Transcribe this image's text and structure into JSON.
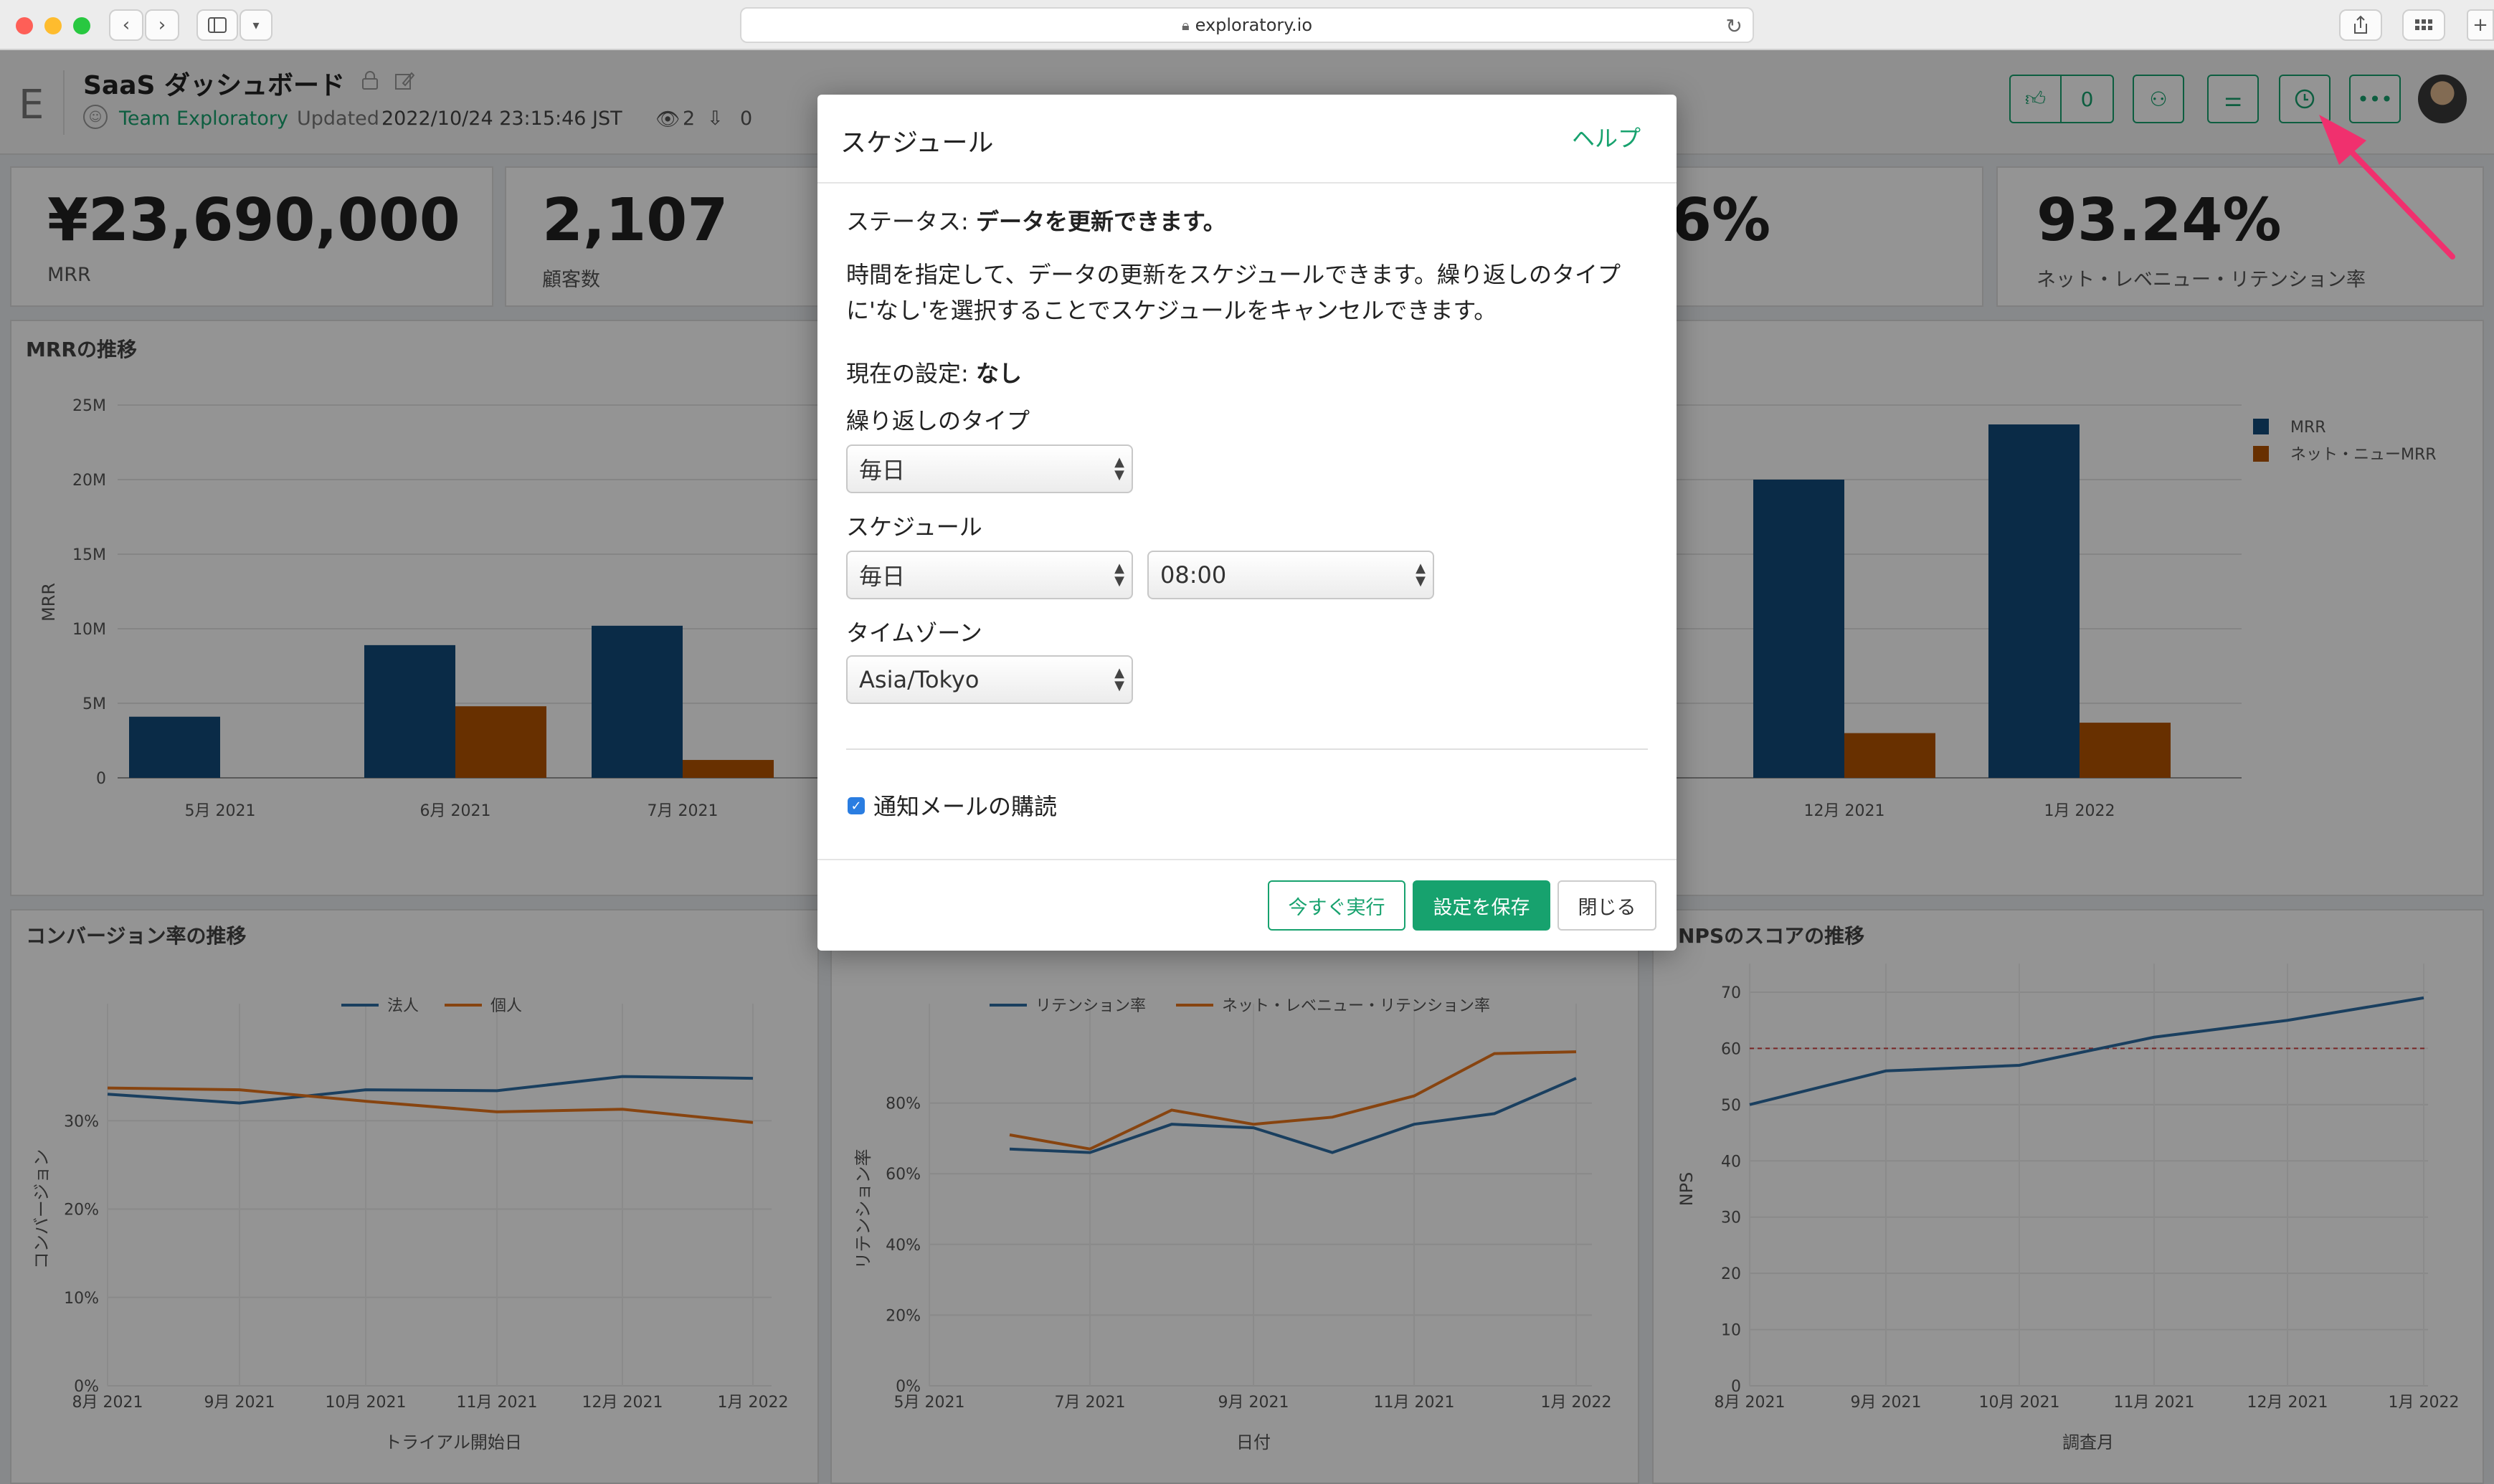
{
  "browser": {
    "url": "exploratory.io",
    "icons": {
      "back": "chevron-left-icon",
      "forward": "chevron-right-icon",
      "sidebar": "sidebar-icon",
      "lock": "lock-icon",
      "reload": "reload-icon",
      "share": "share-icon",
      "tabs": "tab-grid-icon"
    }
  },
  "header": {
    "logo": "E",
    "title": "SaaS ダッシュボード",
    "team": "Team Exploratory",
    "updated_label": "Updated",
    "updated_value": "2022/10/24 23:15:46 JST",
    "views": "2",
    "downloads": "0",
    "like_count": "0"
  },
  "kpis": [
    {
      "value": "¥23,690,000",
      "label": "MRR"
    },
    {
      "value": "2,107",
      "label": "顧客数"
    },
    {
      "value": "6%",
      "label": ""
    },
    {
      "value": "93.24%",
      "label": "ネット・レベニュー・リテンション率"
    }
  ],
  "panels": {
    "mrr": "MRRの推移",
    "conversion": "コンバージョン率の推移",
    "nps": "NPSのスコアの推移"
  },
  "chart_data": [
    {
      "type": "bar",
      "title": "MRRの推移",
      "ylabel": "MRR",
      "ylim": [
        0,
        25000000
      ],
      "yticks": [
        "0",
        "5M",
        "10M",
        "15M",
        "20M",
        "25M"
      ],
      "categories": [
        "5月 2021",
        "6月 2021",
        "7月 2021",
        "12月 2021",
        "1月 2022"
      ],
      "series": [
        {
          "name": "MRR",
          "color": "#124a7a",
          "values": [
            4100000,
            8900000,
            10200000,
            20000000,
            23700000
          ]
        },
        {
          "name": "ネット・ニューMRR",
          "color": "#b35400",
          "values": [
            0,
            4800000,
            1200000,
            3000000,
            3700000
          ]
        }
      ]
    },
    {
      "type": "line",
      "title": "コンバージョン率の推移",
      "xlabel": "トライアル開始日",
      "ylabel": "コンバージョン",
      "ylim": [
        0,
        0.4
      ],
      "yticks": [
        "0%",
        "10%",
        "20%",
        "30%"
      ],
      "x": [
        "8月 2021",
        "9月 2021",
        "10月 2021",
        "11月 2021",
        "12月 2021",
        "1月 2022"
      ],
      "series": [
        {
          "name": "法人",
          "color": "#2e6da4",
          "values": [
            0.33,
            0.32,
            0.335,
            0.334,
            0.35,
            0.348
          ]
        },
        {
          "name": "個人",
          "color": "#e8761c",
          "values": [
            0.337,
            0.335,
            0.322,
            0.31,
            0.313,
            0.298
          ]
        }
      ]
    },
    {
      "type": "line",
      "title": "",
      "xlabel": "日付",
      "ylabel": "リテンション率",
      "ylim": [
        0,
        1.0
      ],
      "yticks": [
        "0%",
        "20%",
        "40%",
        "60%",
        "80%"
      ],
      "x": [
        "5月 2021",
        "6月 2021",
        "7月 2021",
        "8月 2021",
        "9月 2021",
        "10月 2021",
        "11月 2021",
        "12月 2021",
        "1月 2022"
      ],
      "xticks": [
        "5月 2021",
        "7月 2021",
        "9月 2021",
        "11月 2021",
        "1月 2022"
      ],
      "series": [
        {
          "name": "リテンション率",
          "color": "#2e6da4",
          "values": [
            0.67,
            0.66,
            0.74,
            0.73,
            0.66,
            0.74,
            0.77,
            0.87
          ]
        },
        {
          "name": "ネット・レベニュー・リテンション率",
          "color": "#e8761c",
          "values": [
            0.71,
            0.67,
            0.78,
            0.74,
            0.76,
            0.82,
            0.94,
            0.945
          ]
        }
      ]
    },
    {
      "type": "line",
      "title": "NPSのスコアの推移",
      "xlabel": "調査月",
      "ylabel": "NPS",
      "ylim": [
        0,
        70
      ],
      "yticks": [
        "0",
        "10",
        "20",
        "30",
        "40",
        "50",
        "60",
        "70"
      ],
      "reference_line": 60,
      "x": [
        "8月 2021",
        "9月 2021",
        "10月 2021",
        "11月 2021",
        "12月 2021",
        "1月 2022"
      ],
      "series": [
        {
          "name": "NPS",
          "color": "#2e6da4",
          "values": [
            50,
            56,
            57,
            62,
            65,
            69
          ]
        }
      ]
    }
  ],
  "modal": {
    "title": "スケジュール",
    "help": "ヘルプ",
    "status_label": "ステータス:",
    "status_value": "データを更新できます。",
    "description_1": "時間を指定して、データの更新をスケジュールできます。繰り返しのタイプ",
    "description_2": "に'なし'を選択することでスケジュールをキャンセルできます。",
    "current_label": "現在の設定:",
    "current_value": "なし",
    "repeat_label": "繰り返しのタイプ",
    "repeat_value": "毎日",
    "schedule_label": "スケジュール",
    "schedule_value": "毎日",
    "time_value": "08:00",
    "timezone_label": "タイムゾーン",
    "timezone_value": "Asia/Tokyo",
    "notify_label": "通知メールの購読",
    "notify_checked": true,
    "run_now": "今すぐ実行",
    "save": "設定を保存",
    "close": "閉じる"
  },
  "colors": {
    "accent": "#17a26e",
    "annotation": "#f0306e"
  }
}
